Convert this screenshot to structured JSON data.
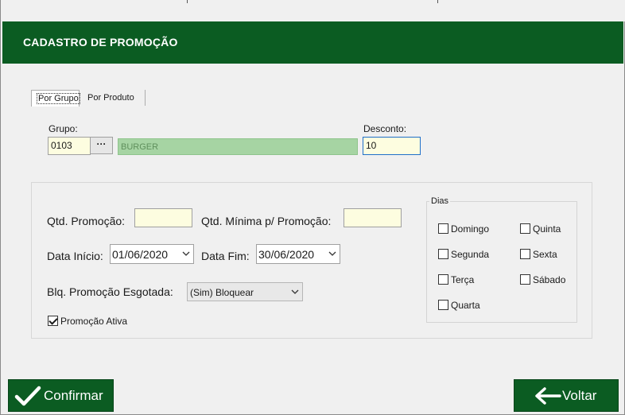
{
  "header": {
    "title": "CADASTRO DE PROMOÇÃO"
  },
  "tabs": [
    {
      "label": "Por Grupo",
      "active": true
    },
    {
      "label": "Por Produto",
      "active": false
    }
  ],
  "grupo": {
    "label": "Grupo:",
    "code": "0103",
    "lookup_label": "···",
    "name": "BURGER"
  },
  "desconto": {
    "label": "Desconto:",
    "value": "10"
  },
  "qtd_promocao": {
    "label": "Qtd. Promoção:",
    "value": ""
  },
  "qtd_minima": {
    "label": "Qtd. Mínima p/ Promoção:",
    "value": ""
  },
  "data_inicio": {
    "label": "Data Início:",
    "value": "01/06/2020"
  },
  "data_fim": {
    "label": "Data Fim:",
    "value": "30/06/2020"
  },
  "bloqueio": {
    "label": "Blq. Promoção Esgotada:",
    "value": "(Sim) Bloquear"
  },
  "promocao_ativa": {
    "label": "Promoção Ativa",
    "checked": true
  },
  "dias": {
    "legend": "Dias",
    "items": [
      {
        "label": "Domingo",
        "checked": false
      },
      {
        "label": "Segunda",
        "checked": false
      },
      {
        "label": "Terça",
        "checked": false
      },
      {
        "label": "Quarta",
        "checked": false
      },
      {
        "label": "Quinta",
        "checked": false
      },
      {
        "label": "Sexta",
        "checked": false
      },
      {
        "label": "Sábado",
        "checked": false
      }
    ]
  },
  "buttons": {
    "confirmar": "Confirmar",
    "voltar": "Voltar"
  },
  "colors": {
    "header": "#0b5c22",
    "button": "#0b5c22",
    "input_bg": "#fdfde0",
    "group_name_bg": "#a6d4a3",
    "focus_border": "#1f6fc9"
  }
}
